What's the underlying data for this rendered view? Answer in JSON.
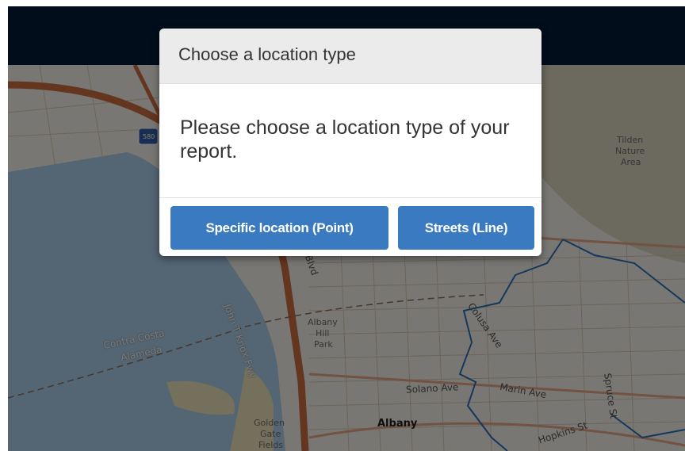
{
  "modal": {
    "title": "Choose a location type",
    "message": "Please choose a location type of your report.",
    "buttons": {
      "point": "Specific location (Point)",
      "line": "Streets (Line)"
    }
  },
  "map": {
    "labels": {
      "tilden_1": "Tilden",
      "tilden_2": "Nature",
      "tilden_3": "Area",
      "highway_shield": "580",
      "contra_costa": "Contra Costa",
      "alameda": "Alameda",
      "albany_hill_1": "Albany",
      "albany_hill_2": "Hill",
      "albany_hill_3": "Park",
      "albany": "Albany",
      "golden_gate_1": "Golden",
      "golden_gate_2": "Gate",
      "golden_gate_3": "Fields",
      "john_t_knox": "John T Knox Fwy",
      "blvd": "Blvd",
      "colusa": "Colusa Ave",
      "solano": "Solano Ave",
      "marin": "Marin Ave",
      "spruce": "Spruce St",
      "hopkins": "Hopkins St"
    }
  },
  "colors": {
    "topbar": "#021a36",
    "button": "#3a7ac0",
    "water": "#a9cbe6",
    "boundary": "#2d6fb8"
  }
}
